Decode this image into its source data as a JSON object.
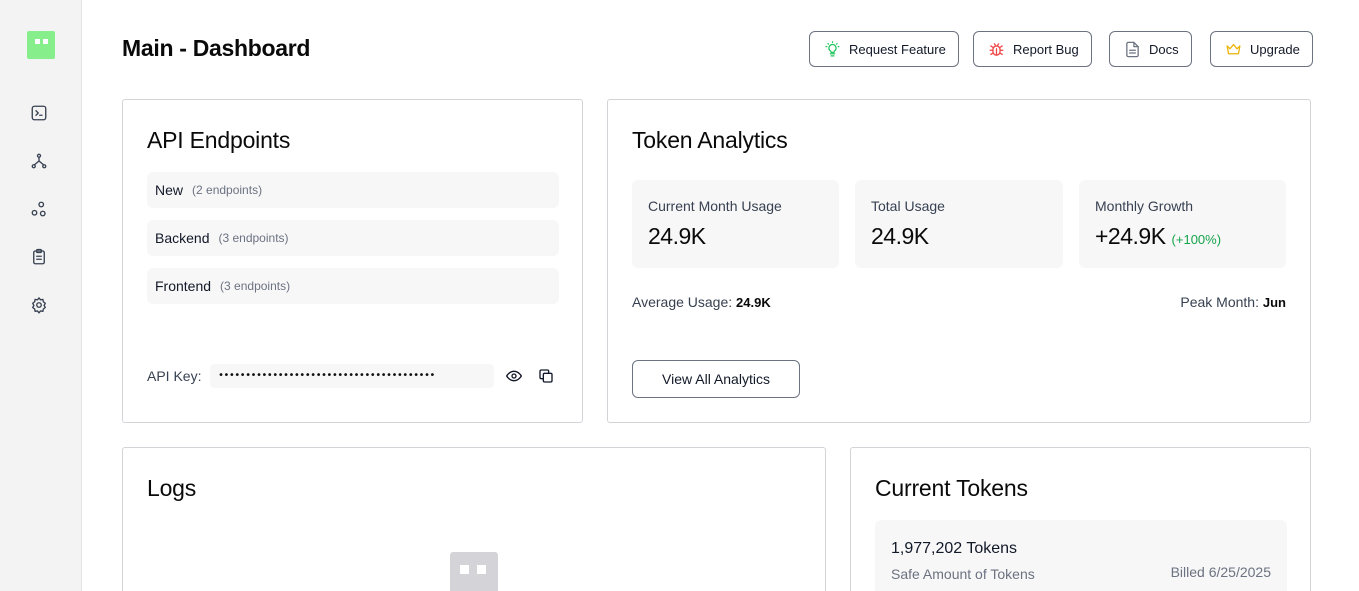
{
  "sidebar": {
    "items": [
      {
        "name": "terminal"
      },
      {
        "name": "network"
      },
      {
        "name": "nodes"
      },
      {
        "name": "clipboard"
      },
      {
        "name": "settings"
      }
    ]
  },
  "header": {
    "title": "Main - Dashboard",
    "buttons": {
      "request_feature": "Request Feature",
      "report_bug": "Report Bug",
      "docs": "Docs",
      "upgrade": "Upgrade"
    }
  },
  "api_endpoints": {
    "title": "API Endpoints",
    "groups": [
      {
        "name": "New",
        "count": "(2 endpoints)"
      },
      {
        "name": "Backend",
        "count": "(3 endpoints)"
      },
      {
        "name": "Frontend",
        "count": "(3 endpoints)"
      }
    ],
    "api_key_label": "API Key:",
    "api_key_masked": "••••••••••••••••••••••••••••••••••••••••"
  },
  "token_analytics": {
    "title": "Token Analytics",
    "stats": {
      "current_month": {
        "label": "Current Month Usage",
        "value": "24.9K"
      },
      "total": {
        "label": "Total Usage",
        "value": "24.9K"
      },
      "growth": {
        "label": "Monthly Growth",
        "value": "+24.9K",
        "percent": "(+100%)"
      }
    },
    "average_label": "Average Usage:",
    "average_value": "24.9K",
    "peak_label": "Peak Month:",
    "peak_value": "Jun",
    "view_all": "View All Analytics"
  },
  "logs": {
    "title": "Logs"
  },
  "current_tokens": {
    "title": "Current Tokens",
    "amount": "1,977,202 Tokens",
    "status": "Safe Amount of Tokens",
    "billed": "Billed 6/25/2025"
  },
  "colors": {
    "brand": "#86ef8c",
    "growth": "#16a34a",
    "bug_icon": "#ef4444",
    "idea_icon": "#22c55e",
    "crown_icon": "#eab308"
  }
}
